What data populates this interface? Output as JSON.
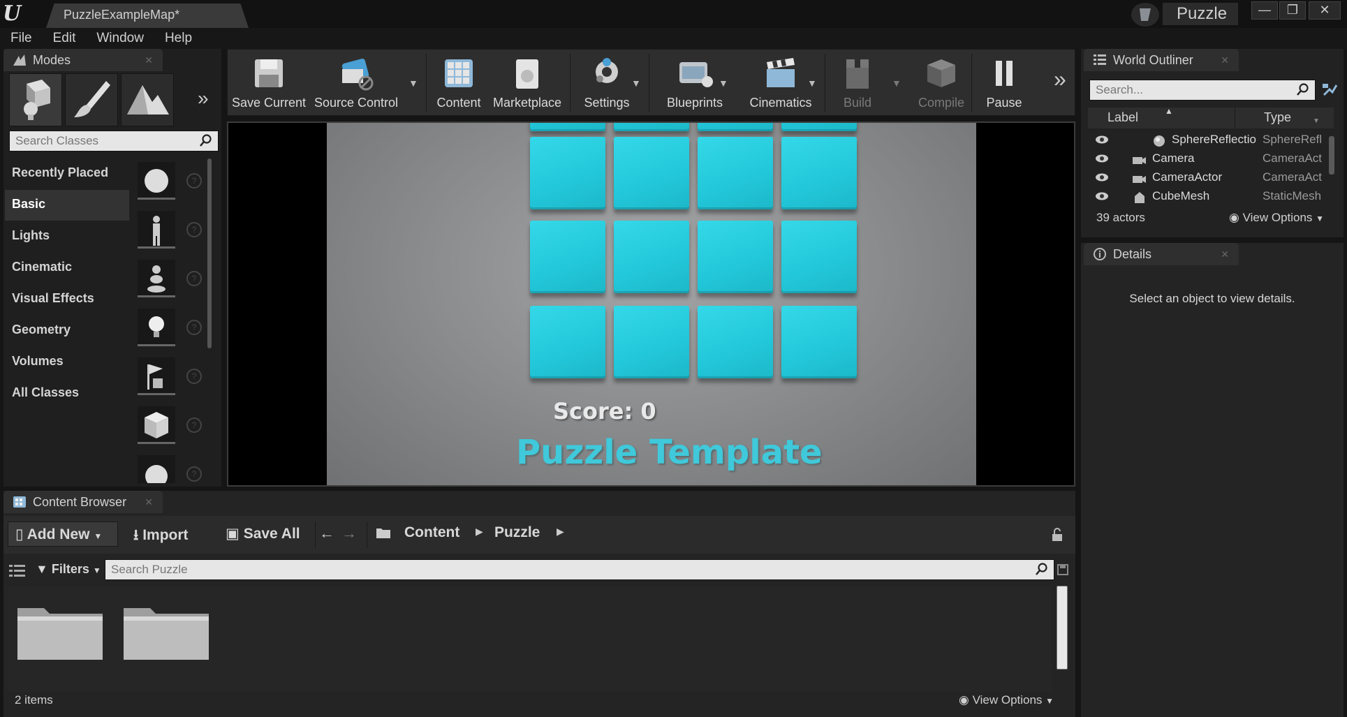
{
  "window": {
    "tab_title": "PuzzleExampleMap*",
    "project_name": "Puzzle",
    "buttons": {
      "minimize": "—",
      "maximize": "❐",
      "close": "✕"
    }
  },
  "menu": [
    "File",
    "Edit",
    "Window",
    "Help"
  ],
  "modes": {
    "tab_label": "Modes",
    "search_placeholder": "Search Classes",
    "categories": [
      "Recently Placed",
      "Basic",
      "Lights",
      "Cinematic",
      "Visual Effects",
      "Geometry",
      "Volumes",
      "All Classes"
    ],
    "active_category": "Basic",
    "more_glyph": "»"
  },
  "toolbar": {
    "items": [
      "Save Current",
      "Source Control",
      "Content",
      "Marketplace",
      "Settings",
      "Blueprints",
      "Cinematics",
      "Build",
      "Compile",
      "Pause"
    ],
    "more_glyph": "»"
  },
  "viewport": {
    "score_text": "Score: 0",
    "title_text": "Puzzle Template",
    "tile_color": "#22c7d9"
  },
  "outliner": {
    "tab_label": "World Outliner",
    "search_placeholder": "Search...",
    "columns": {
      "label": "Label",
      "type": "Type"
    },
    "rows": [
      {
        "label": "SphereReflectio",
        "type": "SphereRefl"
      },
      {
        "label": "Camera",
        "type": "CameraAct"
      },
      {
        "label": "CameraActor",
        "type": "CameraAct"
      },
      {
        "label": "CubeMesh",
        "type": "StaticMesh"
      }
    ],
    "actors_count": "39 actors",
    "view_options": "View Options"
  },
  "details": {
    "tab_label": "Details",
    "empty_message": "Select an object to view details."
  },
  "content_browser": {
    "tab_label": "Content Browser",
    "add_new": "Add New",
    "import": "Import",
    "save_all": "Save All",
    "breadcrumb": [
      "Content",
      "Puzzle"
    ],
    "filters": "Filters",
    "search_placeholder": "Search Puzzle",
    "items_count": "2 items",
    "view_options": "View Options"
  }
}
